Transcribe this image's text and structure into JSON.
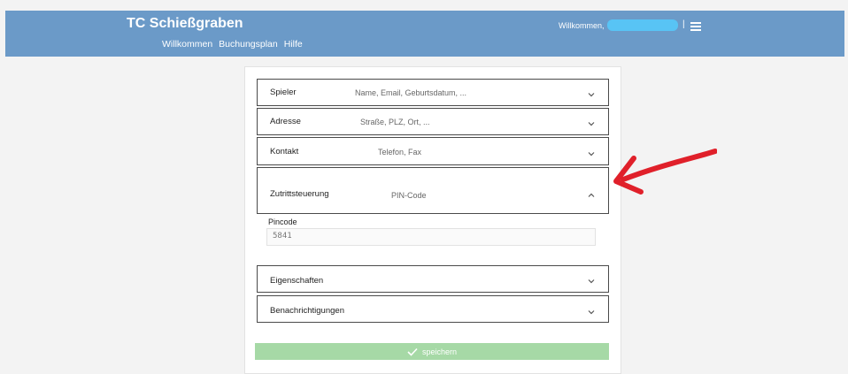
{
  "header": {
    "brand": "TC Schießgraben",
    "nav": [
      "Willkommen",
      "Buchungsplan",
      "Hilfe"
    ],
    "welcome": "Willkommen,",
    "separator": "|",
    "menu_icon": "hamburger-menu-icon"
  },
  "sections": [
    {
      "title": "Spieler",
      "subtitle": "Name, Email, Geburtsdatum, ...",
      "expanded": false
    },
    {
      "title": "Adresse",
      "subtitle": "Straße, PLZ, Ort, ...",
      "expanded": false
    },
    {
      "title": "Kontakt",
      "subtitle": "Telefon, Fax",
      "expanded": false
    },
    {
      "title": "Zutrittsteuerung",
      "subtitle": "PIN-Code",
      "expanded": true
    },
    {
      "title": "Eigenschaften",
      "subtitle": "",
      "expanded": false
    },
    {
      "title": "Benachrichtigungen",
      "subtitle": "",
      "expanded": false
    }
  ],
  "pincode": {
    "label": "Pincode",
    "value": "5841"
  },
  "save_button": {
    "label": "speichern",
    "icon": "checkmark-icon"
  },
  "colors": {
    "header_bg": "#6b9ac8",
    "save_bg": "#a6d9a6",
    "annotation_arrow": "#e0202a",
    "user_pill": "#58c4f5"
  }
}
